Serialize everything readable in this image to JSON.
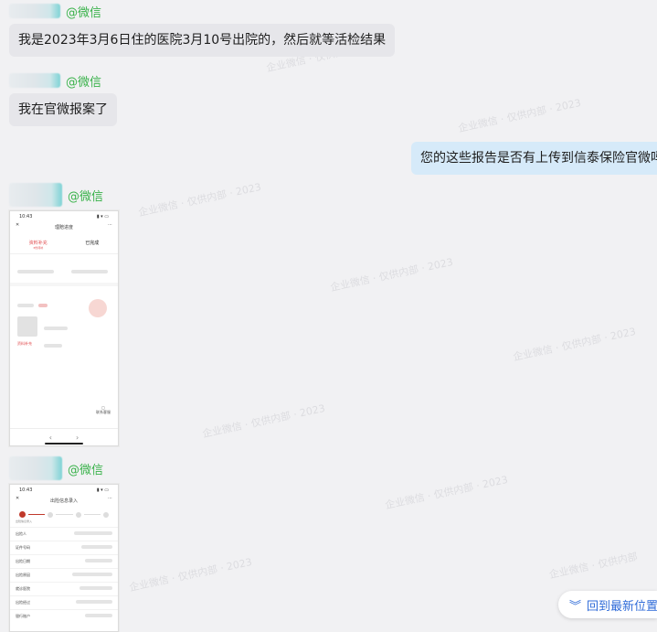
{
  "messages": [
    {
      "sender_tag": "@微信",
      "text": "我是2023年3月6日住的医院3月10号出院的，然后就等活检结果"
    },
    {
      "sender_tag": "@微信",
      "text": "我在官微报案了"
    },
    {
      "text": "您的这些报告是否有上传到信泰保险官微吗"
    },
    {
      "sender_tag": "@微信"
    },
    {
      "sender_tag": "@微信"
    }
  ],
  "screenshot1": {
    "time": "10:43",
    "title": "理赔进度",
    "tab_active": "资料补充",
    "tab_active_sub": "3份待补",
    "tab_other": "已完成",
    "red_label": "资料补充",
    "footer_label": "联系客服",
    "nav_back": "‹",
    "nav_forward": "›"
  },
  "screenshot2": {
    "time": "10:43",
    "title": "出险信息录入",
    "step_label": "出险信息录入",
    "rows": [
      "出险人",
      "证件号码",
      "出险日期",
      "出险原因",
      "就诊医院",
      "出险经过",
      "银行账户"
    ]
  },
  "jump_button": {
    "label": "回到最新位置",
    "icon": "double-chevron-down-icon"
  },
  "colors": {
    "sender_green": "#39b24a",
    "link_blue": "#2f6bd8",
    "right_bubble": "#d6eaf9"
  }
}
